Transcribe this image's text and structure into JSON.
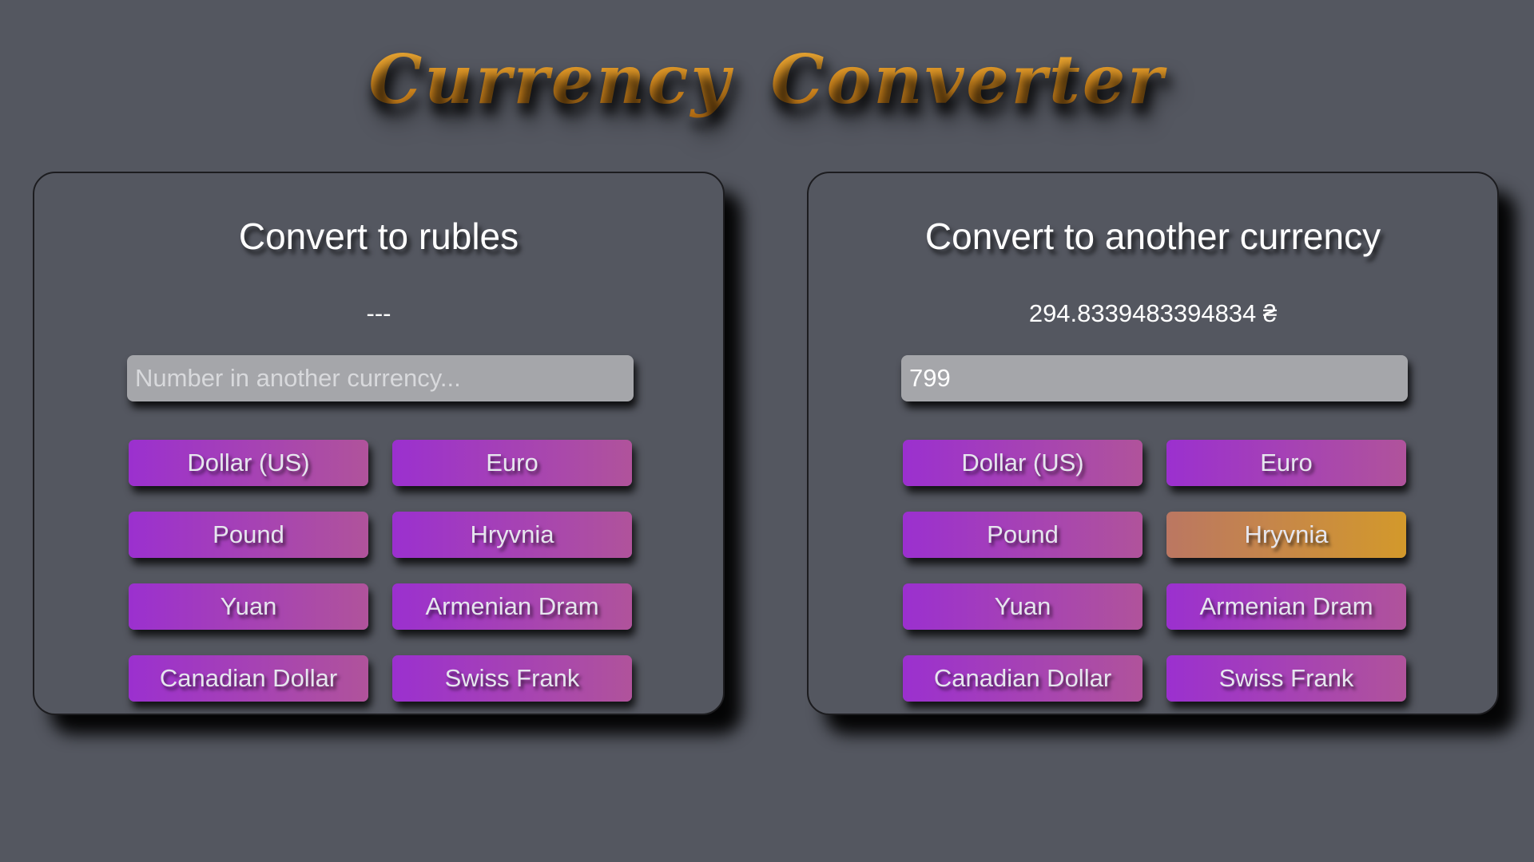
{
  "app": {
    "title": "Currency Converter"
  },
  "panels": [
    {
      "title": "Convert to rubles",
      "result": "---",
      "input": {
        "value": "",
        "placeholder": "Number in another currency..."
      },
      "buttons": [
        "Dollar (US)",
        "Euro",
        "Pound",
        "Hryvnia",
        "Yuan",
        "Armenian Dram",
        "Canadian Dollar",
        "Swiss Frank"
      ],
      "active_button": null
    },
    {
      "title": "Convert to another currency",
      "result": "294.8339483394834 ₴",
      "input": {
        "value": "799",
        "placeholder": ""
      },
      "buttons": [
        "Dollar (US)",
        "Euro",
        "Pound",
        "Hryvnia",
        "Yuan",
        "Armenian Dram",
        "Canadian Dollar",
        "Swiss Frank"
      ],
      "active_button": "Hryvnia"
    }
  ],
  "colors": {
    "background": "#545760",
    "title_gold": "#e5982a",
    "button_gradient_start": "#9b30cf",
    "button_gradient_end": "#b0539b",
    "active_gradient_start": "#bb7762",
    "active_gradient_end": "#d3992b",
    "input_background": "#a5a6aa"
  }
}
